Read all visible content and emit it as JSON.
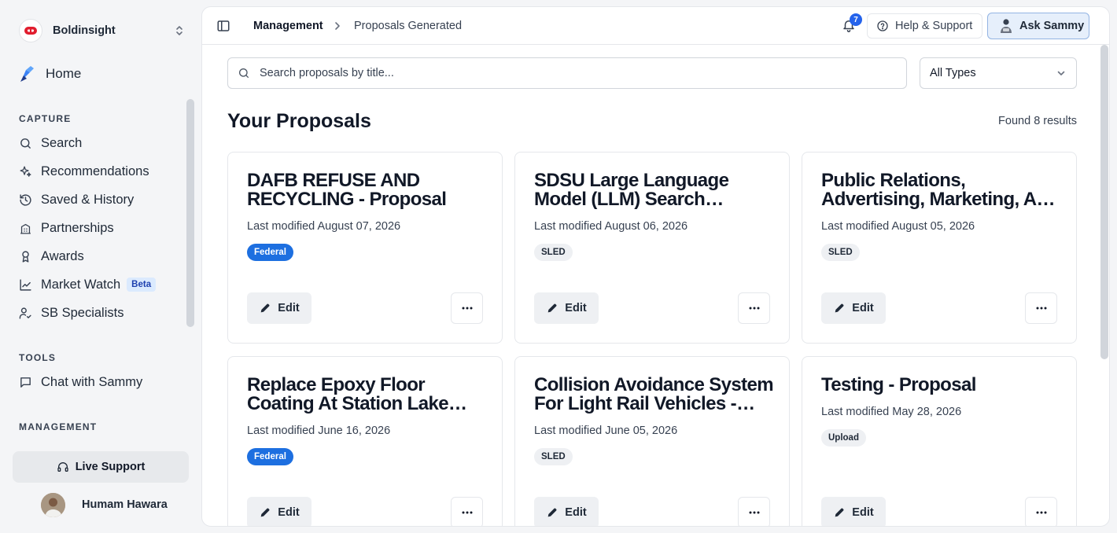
{
  "sidebar": {
    "org_name": "Boldinsight",
    "home_label": "Home",
    "sections": {
      "capture": "CAPTURE",
      "tools": "TOOLS",
      "management": "MANAGEMENT"
    },
    "capture_items": [
      {
        "label": "Search",
        "icon": "search-icon"
      },
      {
        "label": "Recommendations",
        "icon": "sparkles-icon"
      },
      {
        "label": "Saved & History",
        "icon": "history-icon"
      },
      {
        "label": "Partnerships",
        "icon": "building-icon"
      },
      {
        "label": "Awards",
        "icon": "award-icon"
      },
      {
        "label": "Market Watch",
        "icon": "chart-line-icon",
        "badge": "Beta"
      },
      {
        "label": "SB Specialists",
        "icon": "user-check-icon"
      }
    ],
    "tools_items": [
      {
        "label": "Chat with Sammy",
        "icon": "message-square-icon"
      }
    ],
    "live_support": "Live Support",
    "user_name": "Humam Hawara"
  },
  "header": {
    "breadcrumb": [
      "Management",
      "Proposals Generated"
    ],
    "notifications_count": "7",
    "help_label": "Help & Support",
    "ask_label": "Ask Sammy"
  },
  "filters": {
    "search_placeholder": "Search proposals by title...",
    "type_selected": "All Types"
  },
  "page": {
    "title": "Your Proposals",
    "results": "Found 8 results"
  },
  "proposals": [
    {
      "title": "DAFB REFUSE AND RECYCLING - Proposal",
      "date": "Last modified August 07, 2026",
      "type": "Federal",
      "edit": "Edit"
    },
    {
      "title": "SDSU Large Language Model (LLM) Search Proposal",
      "date": "Last modified August 06, 2026",
      "type": "SLED",
      "edit": "Edit"
    },
    {
      "title": "Public Relations, Advertising, Marketing, And Multimedia Services - Proposal",
      "date": "Last modified August 05, 2026",
      "type": "SLED",
      "edit": "Edit"
    },
    {
      "title": "Replace Epoxy Floor Coating At Station Lake Tahoe - Proposal",
      "date": "Last modified June 16, 2026",
      "type": "Federal",
      "edit": "Edit"
    },
    {
      "title": "Collision Avoidance System For Light Rail Vehicles - Proposal",
      "date": "Last modified June 05, 2026",
      "type": "SLED",
      "edit": "Edit"
    },
    {
      "title": "Testing - Proposal",
      "date": "Last modified May 28, 2026",
      "type": "Upload",
      "edit": "Edit"
    }
  ],
  "colors": {
    "accent": "#2563eb",
    "federal_badge": "#1d6fe0",
    "neutral_badge": "#eef0f3"
  }
}
